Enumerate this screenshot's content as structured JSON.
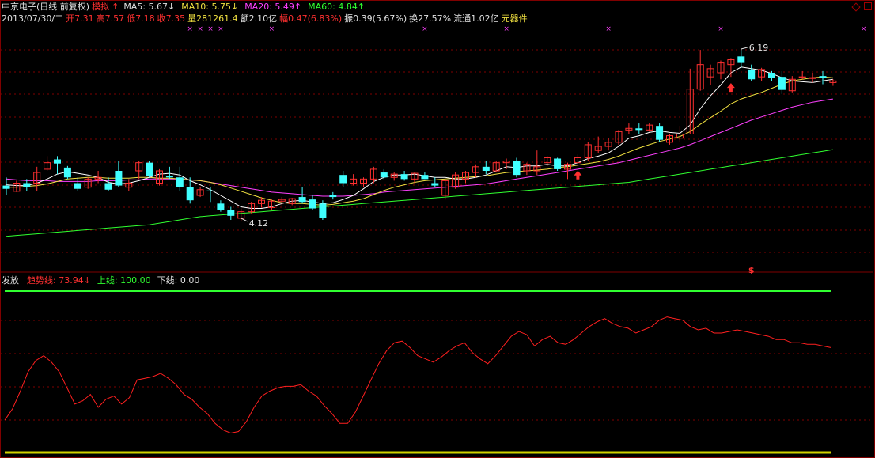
{
  "header": {
    "stock_name": "中京电子(日线 前复权)",
    "mode": "模拟",
    "mode_arrow": "↑",
    "ma5": "MA5: 5.67↓",
    "ma10": "MA10: 5.75↓",
    "ma20": "MA20: 5.49↑",
    "ma60": "MA60: 4.84↑"
  },
  "quote": {
    "date": "2013/07/30/二",
    "open": "开7.31",
    "high": "高7.57",
    "low": "低7.18",
    "close": "收7.35",
    "volume": "量281261.4",
    "amount": "额2.10亿",
    "change": "幅0.47(6.83%)",
    "amplitude": "振0.39(5.67%)",
    "turnover": "换27.57%",
    "float": "流通1.02亿",
    "industry": "元器件"
  },
  "indicator": {
    "name": "发放",
    "trend": "趋势线: 73.94↓",
    "upper": "上线: 100.00",
    "lower": "下线: 0.00"
  },
  "annotations": {
    "high_price": "6.19",
    "low_price": "4.12",
    "marker": "$"
  },
  "colors": {
    "up": "#ff3030",
    "down": "#40ffff",
    "ma5": "#ffffff",
    "ma10": "#f0e040",
    "ma20": "#ff40ff",
    "ma60": "#30ff30",
    "trend": "#ff2020",
    "upper": "#30ff30",
    "lower": "#d0d000",
    "grid": "#800000",
    "marks": "#ff40ff"
  },
  "chart_data": [
    {
      "type": "candlestick",
      "title": "中京电子(日线 前复权)",
      "ylim": [
        3.5,
        6.5
      ],
      "candles": [
        [
          4.52,
          4.62,
          4.4,
          4.48
        ],
        [
          4.45,
          4.58,
          4.44,
          4.55
        ],
        [
          4.55,
          4.6,
          4.45,
          4.5
        ],
        [
          4.55,
          4.75,
          4.45,
          4.68
        ],
        [
          4.72,
          4.88,
          4.7,
          4.8
        ],
        [
          4.84,
          4.88,
          4.66,
          4.79
        ],
        [
          4.74,
          4.76,
          4.6,
          4.62
        ],
        [
          4.55,
          4.62,
          4.45,
          4.48
        ],
        [
          4.5,
          4.62,
          4.48,
          4.6
        ],
        [
          4.6,
          4.7,
          4.55,
          4.62
        ],
        [
          4.55,
          4.62,
          4.45,
          4.47
        ],
        [
          4.7,
          4.82,
          4.5,
          4.52
        ],
        [
          4.5,
          4.6,
          4.45,
          4.55
        ],
        [
          4.7,
          4.82,
          4.6,
          4.8
        ],
        [
          4.8,
          4.82,
          4.62,
          4.64
        ],
        [
          4.55,
          4.72,
          4.52,
          4.7
        ],
        [
          4.64,
          4.75,
          4.6,
          4.62
        ],
        [
          4.62,
          4.75,
          4.45,
          4.5
        ],
        [
          4.5,
          4.62,
          4.3,
          4.34
        ],
        [
          4.4,
          4.5,
          4.38,
          4.47
        ],
        [
          4.46,
          4.5,
          4.32,
          4.45
        ],
        [
          4.3,
          4.34,
          4.2,
          4.22
        ],
        [
          4.22,
          4.26,
          4.1,
          4.15
        ],
        [
          4.12,
          4.24,
          4.08,
          4.2
        ],
        [
          4.2,
          4.32,
          4.18,
          4.3
        ],
        [
          4.3,
          4.38,
          4.25,
          4.34
        ],
        [
          4.25,
          4.35,
          4.22,
          4.33
        ],
        [
          4.33,
          4.38,
          4.28,
          4.35
        ],
        [
          4.3,
          4.37,
          4.28,
          4.36
        ],
        [
          4.38,
          4.5,
          4.3,
          4.32
        ],
        [
          4.35,
          4.4,
          4.22,
          4.24
        ],
        [
          4.3,
          4.34,
          4.1,
          4.12
        ],
        [
          4.4,
          4.44,
          4.35,
          4.38
        ],
        [
          4.65,
          4.7,
          4.5,
          4.55
        ],
        [
          4.55,
          4.66,
          4.52,
          4.6
        ],
        [
          4.55,
          4.62,
          4.5,
          4.6
        ],
        [
          4.6,
          4.75,
          4.55,
          4.72
        ],
        [
          4.68,
          4.72,
          4.6,
          4.62
        ],
        [
          4.62,
          4.68,
          4.58,
          4.66
        ],
        [
          4.66,
          4.7,
          4.58,
          4.6
        ],
        [
          4.6,
          4.68,
          4.55,
          4.67
        ],
        [
          4.65,
          4.68,
          4.6,
          4.6
        ],
        [
          4.55,
          4.62,
          4.5,
          4.52
        ],
        [
          4.4,
          4.6,
          4.35,
          4.58
        ],
        [
          4.5,
          4.68,
          4.48,
          4.65
        ],
        [
          4.6,
          4.7,
          4.55,
          4.68
        ],
        [
          4.68,
          4.78,
          4.62,
          4.75
        ],
        [
          4.75,
          4.82,
          4.66,
          4.7
        ],
        [
          4.7,
          4.82,
          4.68,
          4.8
        ],
        [
          4.8,
          4.85,
          4.72,
          4.82
        ],
        [
          4.82,
          4.86,
          4.62,
          4.65
        ],
        [
          4.7,
          4.8,
          4.65,
          4.78
        ],
        [
          4.7,
          4.95,
          4.65,
          4.75
        ],
        [
          4.8,
          4.88,
          4.76,
          4.86
        ],
        [
          4.85,
          4.86,
          4.7,
          4.72
        ],
        [
          4.72,
          4.8,
          4.6,
          4.78
        ],
        [
          4.8,
          4.9,
          4.78,
          4.86
        ],
        [
          4.86,
          5.05,
          4.82,
          5.02
        ],
        [
          4.95,
          5.12,
          4.92,
          5.0
        ],
        [
          5.0,
          5.1,
          4.95,
          5.05
        ],
        [
          5.05,
          5.2,
          5.02,
          5.18
        ],
        [
          5.2,
          5.28,
          5.15,
          5.22
        ],
        [
          5.22,
          5.28,
          5.15,
          5.2
        ],
        [
          5.2,
          5.28,
          5.18,
          5.26
        ],
        [
          5.25,
          5.28,
          5.05,
          5.08
        ],
        [
          5.05,
          5.15,
          5.02,
          5.13
        ],
        [
          5.1,
          5.25,
          5.05,
          5.15
        ],
        [
          5.15,
          5.95,
          5.15,
          5.7
        ],
        [
          5.7,
          6.18,
          5.68,
          6.0
        ],
        [
          5.85,
          6.0,
          5.75,
          5.95
        ],
        [
          5.9,
          6.05,
          5.82,
          6.02
        ],
        [
          6.0,
          6.08,
          5.85,
          6.06
        ],
        [
          6.1,
          6.19,
          5.96,
          6.02
        ],
        [
          5.94,
          6.0,
          5.8,
          5.82
        ],
        [
          5.85,
          5.96,
          5.8,
          5.94
        ],
        [
          5.9,
          5.92,
          5.8,
          5.84
        ],
        [
          5.85,
          5.92,
          5.64,
          5.69
        ],
        [
          5.68,
          5.86,
          5.66,
          5.82
        ],
        [
          5.84,
          5.92,
          5.82,
          5.85
        ],
        [
          5.83,
          5.9,
          5.78,
          5.84
        ],
        [
          5.86,
          5.92,
          5.76,
          5.84
        ],
        [
          5.78,
          5.82,
          5.74,
          5.8
        ]
      ],
      "ma5": [
        4.53,
        4.52,
        4.52,
        4.55,
        4.6,
        4.66,
        4.69,
        4.67,
        4.65,
        4.62,
        4.56,
        4.54,
        4.55,
        4.58,
        4.62,
        4.66,
        4.67,
        4.65,
        4.58,
        4.53,
        4.47,
        4.4,
        4.33,
        4.26,
        4.24,
        4.24,
        4.26,
        4.3,
        4.33,
        4.34,
        4.32,
        4.3,
        4.31,
        4.35,
        4.4,
        4.48,
        4.57,
        4.62,
        4.65,
        4.65,
        4.66,
        4.64,
        4.62,
        4.62,
        4.6,
        4.6,
        4.62,
        4.65,
        4.7,
        4.75,
        4.74,
        4.76,
        4.76,
        4.78,
        4.76,
        4.76,
        4.8,
        4.85,
        4.88,
        4.92,
        5.0,
        5.1,
        5.13,
        5.17,
        5.19,
        5.17,
        5.16,
        5.26,
        5.46,
        5.62,
        5.75,
        5.9,
        5.97,
        5.95,
        5.93,
        5.89,
        5.84,
        5.8,
        5.79,
        5.78,
        5.8,
        5.82
      ],
      "ma10": [
        4.5,
        4.5,
        4.51,
        4.52,
        4.54,
        4.57,
        4.6,
        4.61,
        4.62,
        4.62,
        4.61,
        4.61,
        4.61,
        4.62,
        4.62,
        4.61,
        4.61,
        4.6,
        4.59,
        4.58,
        4.56,
        4.53,
        4.49,
        4.45,
        4.41,
        4.37,
        4.34,
        4.31,
        4.3,
        4.3,
        4.29,
        4.28,
        4.29,
        4.31,
        4.33,
        4.36,
        4.41,
        4.46,
        4.5,
        4.53,
        4.56,
        4.58,
        4.59,
        4.6,
        4.61,
        4.62,
        4.63,
        4.64,
        4.66,
        4.68,
        4.69,
        4.7,
        4.71,
        4.72,
        4.74,
        4.75,
        4.77,
        4.79,
        4.81,
        4.84,
        4.88,
        4.93,
        4.98,
        5.02,
        5.06,
        5.09,
        5.12,
        5.18,
        5.27,
        5.35,
        5.43,
        5.52,
        5.58,
        5.62,
        5.66,
        5.71,
        5.76,
        5.8,
        5.82,
        5.84,
        5.85,
        5.84
      ],
      "ma20": [
        4.6,
        4.59,
        4.58,
        4.58,
        4.58,
        4.57,
        4.57,
        4.57,
        4.57,
        4.58,
        4.58,
        4.58,
        4.59,
        4.59,
        4.6,
        4.6,
        4.6,
        4.6,
        4.59,
        4.58,
        4.56,
        4.54,
        4.52,
        4.5,
        4.48,
        4.46,
        4.44,
        4.43,
        4.42,
        4.41,
        4.4,
        4.39,
        4.39,
        4.39,
        4.4,
        4.41,
        4.42,
        4.44,
        4.45,
        4.46,
        4.47,
        4.48,
        4.49,
        4.5,
        4.51,
        4.52,
        4.53,
        4.54,
        4.56,
        4.58,
        4.6,
        4.62,
        4.64,
        4.66,
        4.68,
        4.7,
        4.72,
        4.74,
        4.76,
        4.78,
        4.8,
        4.83,
        4.86,
        4.89,
        4.92,
        4.95,
        4.98,
        5.02,
        5.07,
        5.12,
        5.17,
        5.22,
        5.27,
        5.32,
        5.36,
        5.4,
        5.44,
        5.48,
        5.51,
        5.54,
        5.56,
        5.58
      ],
      "ma60": [
        3.9,
        3.91,
        3.92,
        3.93,
        3.94,
        3.95,
        3.96,
        3.97,
        3.98,
        3.99,
        4.0,
        4.01,
        4.02,
        4.03,
        4.04,
        4.06,
        4.08,
        4.1,
        4.12,
        4.14,
        4.15,
        4.16,
        4.17,
        4.18,
        4.19,
        4.2,
        4.21,
        4.22,
        4.23,
        4.24,
        4.25,
        4.26,
        4.27,
        4.28,
        4.29,
        4.3,
        4.31,
        4.32,
        4.33,
        4.34,
        4.35,
        4.36,
        4.37,
        4.38,
        4.39,
        4.4,
        4.41,
        4.42,
        4.43,
        4.44,
        4.45,
        4.46,
        4.47,
        4.48,
        4.49,
        4.5,
        4.51,
        4.52,
        4.53,
        4.54,
        4.55,
        4.56,
        4.58,
        4.6,
        4.62,
        4.64,
        4.66,
        4.68,
        4.7,
        4.72,
        4.74,
        4.76,
        4.78,
        4.8,
        4.82,
        4.84,
        4.86,
        4.88,
        4.9,
        4.92,
        4.94,
        4.96
      ],
      "high_label": 6.19,
      "low_label": 4.12,
      "buy_arrows": [
        56,
        71
      ],
      "purple_marks": [
        18,
        19,
        20,
        21,
        26,
        41,
        49,
        59,
        70,
        84
      ],
      "dollar_index": 73
    },
    {
      "type": "line",
      "title": "发放",
      "ylim": [
        0,
        100
      ],
      "series": [
        {
          "name": "趋势线",
          "values": [
            20,
            27,
            38,
            50,
            57,
            60,
            56,
            50,
            40,
            30,
            32,
            36,
            28,
            33,
            35,
            30,
            34,
            45,
            46,
            47,
            49,
            46,
            42,
            36,
            33,
            28,
            24,
            18,
            14,
            12,
            13,
            19,
            28,
            35,
            38,
            40,
            41,
            41,
            42,
            38,
            35,
            29,
            24,
            18,
            18,
            25,
            35,
            45,
            55,
            63,
            68,
            69,
            65,
            60,
            58,
            56,
            59,
            63,
            66,
            68,
            62,
            58,
            55,
            60,
            66,
            72,
            75,
            73,
            66,
            70,
            72,
            68,
            67,
            70,
            74,
            78,
            81,
            83,
            80,
            78,
            77,
            74,
            76,
            78,
            82,
            84,
            83,
            82,
            78,
            76,
            77,
            74,
            74,
            75,
            76,
            75,
            74,
            73,
            72,
            70,
            70,
            68,
            68,
            67,
            67,
            66,
            65
          ]
        }
      ],
      "upper": 100,
      "lower": 0
    }
  ]
}
